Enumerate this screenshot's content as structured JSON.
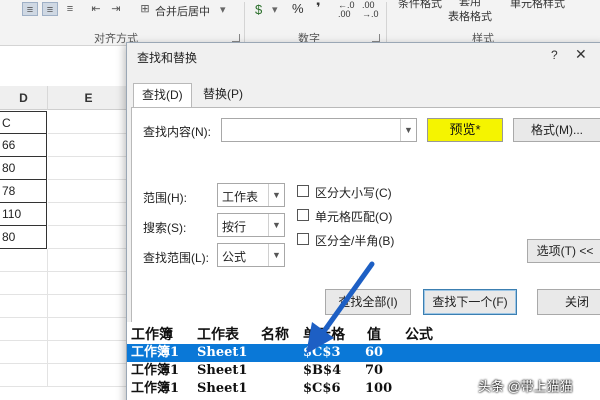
{
  "ribbon": {
    "merge_center_label": "合并后居中",
    "currency_symbol": "$",
    "percent_symbol": "%",
    "comma_symbol": "❜",
    "inc_decimal_label": "←.0\n.00",
    "dec_decimal_label": ".00\n→.0",
    "conditional_format_label": "条件格式",
    "table_format_label": "套用\n表格格式",
    "cell_style_label": "单元格样式",
    "group_alignment": "对齐方式",
    "group_number": "数字",
    "group_styles": "样式"
  },
  "sheet": {
    "col_d": "D",
    "col_e": "E",
    "cells_d": [
      "C",
      "66",
      "80",
      "78",
      "110",
      "80"
    ]
  },
  "dialog": {
    "title": "查找和替换",
    "help": "?",
    "close": "✕",
    "tab_find": "查找(D)",
    "tab_replace": "替换(P)",
    "find_what_label": "查找内容(N):",
    "find_value": "",
    "preview_label": "预览*",
    "format_button": "格式(M)...",
    "within_label": "范围(H):",
    "within_value": "工作表",
    "search_label": "搜索(S):",
    "search_value": "按行",
    "look_in_label": "查找范围(L):",
    "look_in_value": "公式",
    "match_case_label": "区分大小写(C)",
    "match_cell_label": "单元格匹配(O)",
    "match_width_label": "区分全/半角(B)",
    "options_button": "选项(T) <<",
    "find_all_button": "查找全部(I)",
    "find_next_button": "查找下一个(F)",
    "close_button": "关闭"
  },
  "results": {
    "headers": [
      "工作簿",
      "工作表",
      "名称",
      "单元格",
      "值",
      "公式"
    ],
    "rows": [
      {
        "book": "工作簿1",
        "sheet": "Sheet1",
        "cell": "$C$3",
        "value": "60"
      },
      {
        "book": "工作簿1",
        "sheet": "Sheet1",
        "cell": "$B$4",
        "value": "70"
      },
      {
        "book": "工作簿1",
        "sheet": "Sheet1",
        "cell": "$C$6",
        "value": "100"
      }
    ]
  },
  "watermark": "头条 @带上猫猫",
  "colors": {
    "selection": "#0a78d7",
    "preview_bg": "#f5f400",
    "arrow": "#1d5fc4"
  }
}
